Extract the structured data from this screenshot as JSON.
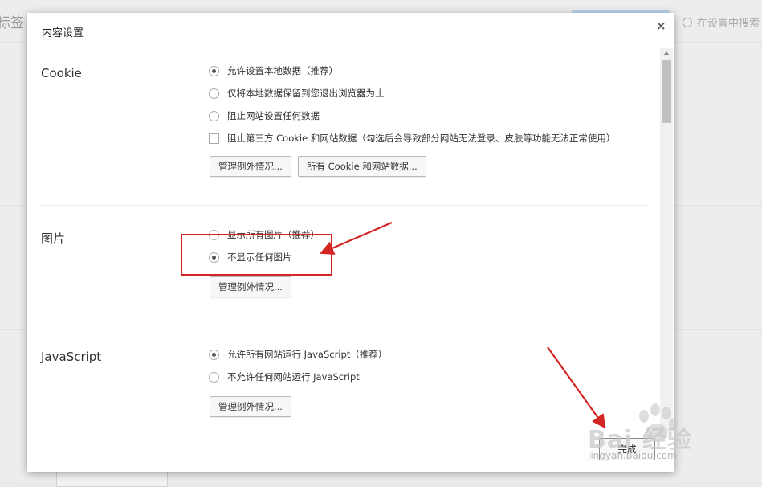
{
  "background": {
    "tab_fragment": "标签",
    "search_placeholder": "在设置中搜索"
  },
  "dialog": {
    "title": "内容设置",
    "close_symbol": "×",
    "done_label": "完成"
  },
  "cookie": {
    "title": "Cookie",
    "options": [
      {
        "label": "允许设置本地数据（推荐）",
        "type": "radio",
        "checked": true
      },
      {
        "label": "仅将本地数据保留到您退出浏览器为止",
        "type": "radio",
        "checked": false
      },
      {
        "label": "阻止网站设置任何数据",
        "type": "radio",
        "checked": false
      },
      {
        "label": "阻止第三方 Cookie 和网站数据（勾选后会导致部分网站无法登录、皮肤等功能无法正常使用）",
        "type": "checkbox",
        "checked": false
      }
    ],
    "buttons": [
      "管理例外情况...",
      "所有 Cookie 和网站数据..."
    ]
  },
  "images": {
    "title": "图片",
    "options": [
      {
        "label": "显示所有图片（推荐）",
        "type": "radio",
        "checked": false
      },
      {
        "label": "不显示任何图片",
        "type": "radio",
        "checked": true
      }
    ],
    "buttons": [
      "管理例外情况..."
    ]
  },
  "javascript": {
    "title": "JavaScript",
    "options": [
      {
        "label": "允许所有网站运行 JavaScript（推荐）",
        "type": "radio",
        "checked": true
      },
      {
        "label": "不允许任何网站运行 JavaScript",
        "type": "radio",
        "checked": false
      }
    ],
    "buttons": [
      "管理例外情况..."
    ]
  },
  "watermark": {
    "brand": "Bai 经验",
    "url": "jingyan.baidu.com"
  },
  "colors": {
    "annotation_red": "#d42525",
    "selected_radio": "#555555"
  }
}
